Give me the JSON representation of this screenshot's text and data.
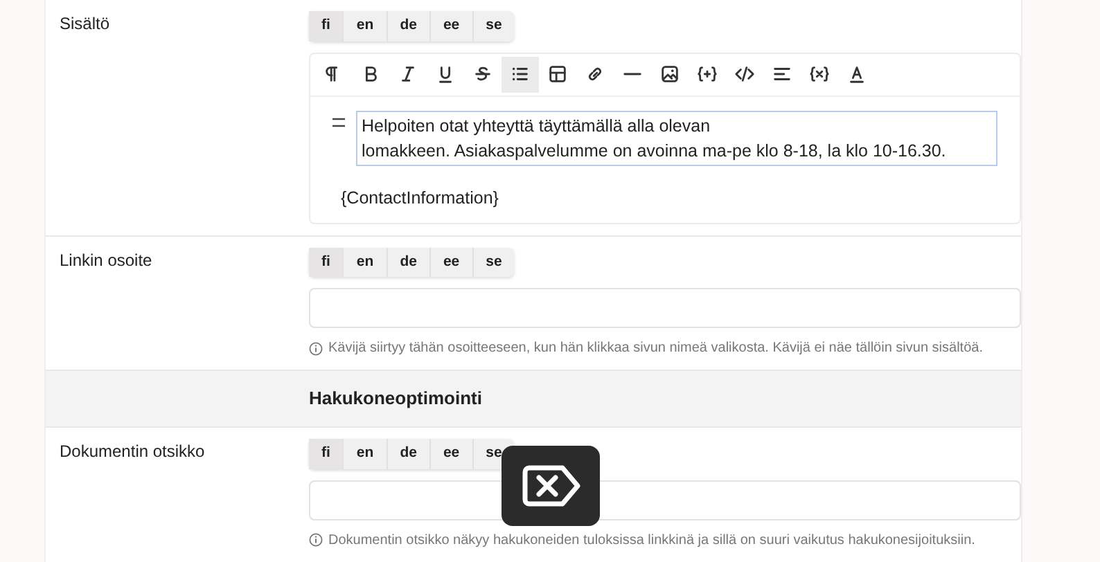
{
  "sections": [
    {
      "kind": "field",
      "label": "Sisältö",
      "languages": [
        {
          "label": "fi",
          "selected": true
        },
        {
          "label": "en",
          "selected": false
        },
        {
          "label": "de",
          "selected": false
        },
        {
          "label": "ee",
          "selected": false
        },
        {
          "label": "se",
          "selected": false
        }
      ],
      "editor": {
        "tools": [
          {
            "kind": "paragraph",
            "selected": false
          },
          {
            "kind": "bold",
            "selected": false
          },
          {
            "kind": "italic",
            "selected": false
          },
          {
            "kind": "underline",
            "selected": false
          },
          {
            "kind": "strike",
            "selected": false
          },
          {
            "kind": "list",
            "selected": true
          },
          {
            "kind": "table",
            "selected": false
          },
          {
            "kind": "link",
            "selected": false
          },
          {
            "kind": "rule",
            "selected": false
          },
          {
            "kind": "image",
            "selected": false
          },
          {
            "kind": "snippet",
            "selected": false
          },
          {
            "kind": "code",
            "selected": false
          },
          {
            "kind": "align",
            "selected": false
          },
          {
            "kind": "variable",
            "selected": false
          },
          {
            "kind": "textcolor",
            "selected": false
          }
        ],
        "list_item": {
          "lines": [
            "Helpoiten otat yhteyttä täyttämällä alla olevan",
            "lomakkeen. Asiakaspalvelumme on avoinna ma-pe klo 8-18, la klo 10-16.30."
          ],
          "focused": true
        },
        "paragraph": "{ContactInformation}"
      }
    },
    {
      "kind": "field",
      "label": "Linkin osoite",
      "languages": [
        {
          "label": "fi",
          "selected": true
        },
        {
          "label": "en",
          "selected": false
        },
        {
          "label": "de",
          "selected": false
        },
        {
          "label": "ee",
          "selected": false
        },
        {
          "label": "se",
          "selected": false
        }
      ],
      "help": "Kävijä siirtyy tähän osoitteeseen, kun hän klikkaa sivun nimeä valikosta. Kävijä ei näe tällöin sivun sisältöä."
    },
    {
      "kind": "heading",
      "label": "Hakukoneoptimointi"
    },
    {
      "kind": "field",
      "label": "Dokumentin otsikko",
      "languages": [
        {
          "label": "fi",
          "selected": true
        },
        {
          "label": "en",
          "selected": false
        },
        {
          "label": "de",
          "selected": false
        },
        {
          "label": "ee",
          "selected": false
        },
        {
          "label": "se",
          "selected": false
        }
      ],
      "help": "Dokumentin otsikko näkyy hakukoneiden tuloksissa linkkinä ja sillä on suuri vaikutus hakukonesijoituksiin."
    }
  ]
}
